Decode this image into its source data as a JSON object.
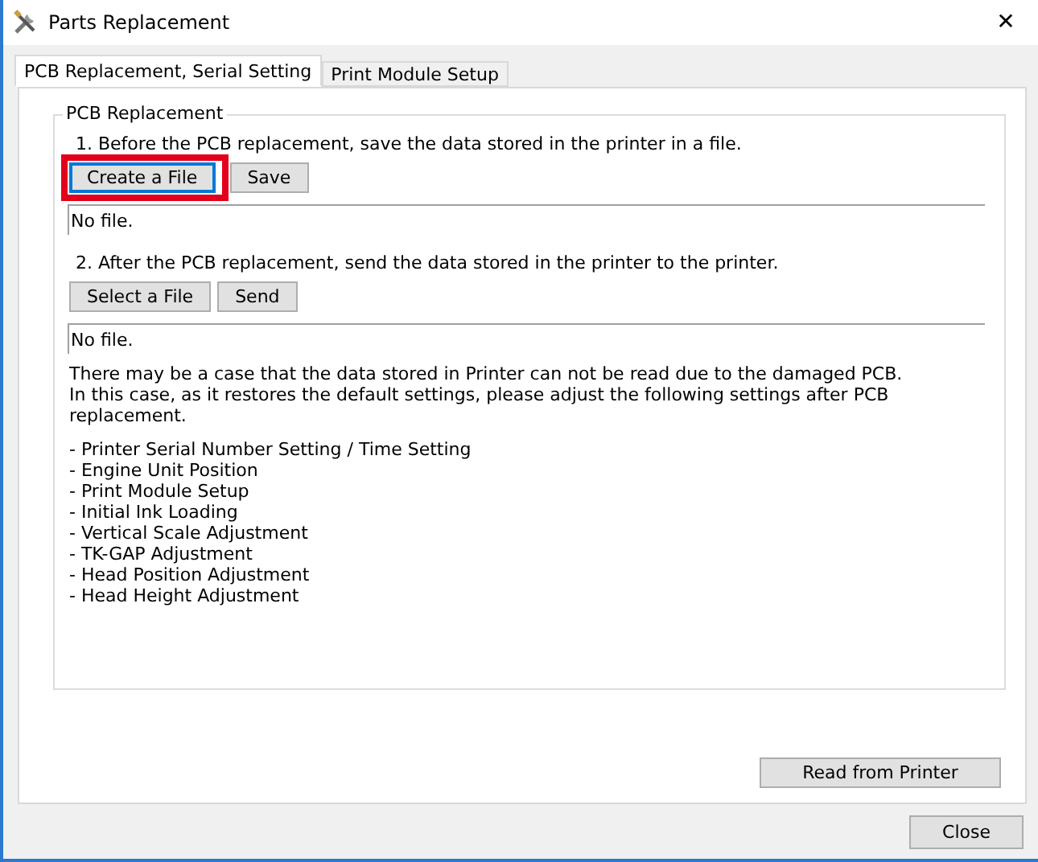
{
  "window": {
    "title": "Parts Replacement",
    "close": "✕"
  },
  "tabs": [
    {
      "label": "PCB Replacement, Serial Setting",
      "selected": true
    },
    {
      "label": "Print Module Setup",
      "selected": false
    }
  ],
  "group": {
    "title": "PCB Replacement",
    "step1": {
      "text": "1. Before the PCB replacement, save the data stored in the printer in a file.",
      "buttons": [
        {
          "label": "Create a File",
          "highlighted": true
        },
        {
          "label": "Save",
          "highlighted": false
        }
      ],
      "file": "No file."
    },
    "step2": {
      "text": "2. After the PCB replacement, send the data stored in the printer to the printer.",
      "buttons": [
        {
          "label": "Select a File",
          "highlighted": false
        },
        {
          "label": "Send",
          "highlighted": false
        }
      ],
      "file": "No file."
    },
    "notes": [
      "There may be a case that the data stored in Printer can not be read due to the damaged PCB.",
      "In this case, as it restores the default settings, please adjust the following settings after PCB replacement."
    ],
    "items": [
      "- Printer Serial Number Setting / Time Setting",
      "- Engine Unit Position",
      "- Print Module Setup",
      "- Initial Ink Loading",
      "- Vertical Scale Adjustment",
      "- TK-GAP Adjustment",
      "- Head Position Adjustment",
      "- Head Height Adjustment"
    ]
  },
  "read_button": "Read from Printer",
  "close_button": "Close"
}
